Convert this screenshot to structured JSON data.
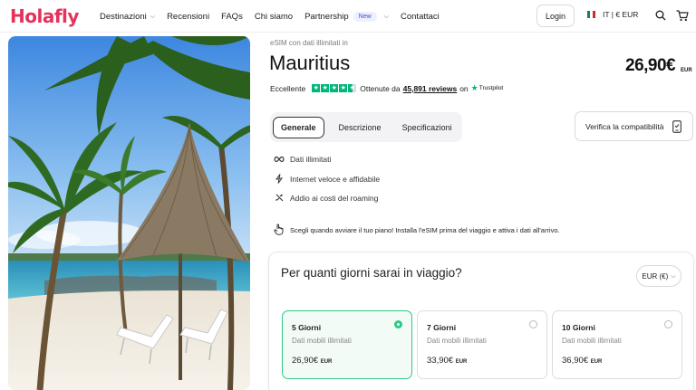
{
  "header": {
    "logo": "Holafly",
    "nav": [
      {
        "label": "Destinazioni",
        "has_chevron": true
      },
      {
        "label": "Recensioni"
      },
      {
        "label": "FAQs"
      },
      {
        "label": "Chi siamo"
      },
      {
        "label": "Partnership",
        "badge": "New",
        "has_chevron": true
      },
      {
        "label": "Contattaci"
      }
    ],
    "login_label": "Login",
    "lang_label": "IT | € EUR",
    "search_icon": "search-icon",
    "cart_icon": "cart-icon"
  },
  "hero": {
    "image": "tropical-beach-with-straw-umbrella"
  },
  "product": {
    "subtitle": "eSIM con dati illimitati in",
    "title": "Mauritius",
    "price": "26,90€",
    "price_currency": "EUR",
    "rating_label": "Eccellente",
    "rating_stars": 4.5,
    "reviews_prefix": "Ottenute da",
    "reviews_count": "45,891 reviews",
    "reviews_on": "on",
    "trustpilot": "Trustpilot"
  },
  "tabs": [
    {
      "label": "Generale",
      "active": true
    },
    {
      "label": "Descrizione",
      "active": false
    },
    {
      "label": "Specificazioni",
      "active": false
    }
  ],
  "compat_button": "Verifica la compatibilità",
  "features": [
    {
      "icon": "infinity-icon",
      "label": "Dati illimitati"
    },
    {
      "icon": "lightning-icon",
      "label": "Internet veloce e affidabile"
    },
    {
      "icon": "no-roaming-icon",
      "label": "Addio ai costi del roaming"
    }
  ],
  "tip": {
    "icon": "hand-pointer-icon",
    "text": "Scegli quando avviare il tuo piano! Installa l'eSIM prima del viaggio e attiva i dati all'arrivo."
  },
  "plan": {
    "question": "Per quanti giorni sarai in viaggio?",
    "currency": "EUR (€)",
    "options": [
      {
        "days": "5 Giorni",
        "data": "Dati mobili illimitati",
        "price": "26,90€",
        "cur": "EUR",
        "selected": true
      },
      {
        "days": "7 Giorni",
        "data": "Dati mobili illimitati",
        "price": "33,90€",
        "cur": "EUR",
        "selected": false
      },
      {
        "days": "10 Giorni",
        "data": "Dati mobili illimitati",
        "price": "36,90€",
        "cur": "EUR",
        "selected": false
      }
    ]
  },
  "colors": {
    "brand": "#e5315b",
    "accent_green": "#32c887",
    "trustpilot_green": "#00b67a"
  }
}
